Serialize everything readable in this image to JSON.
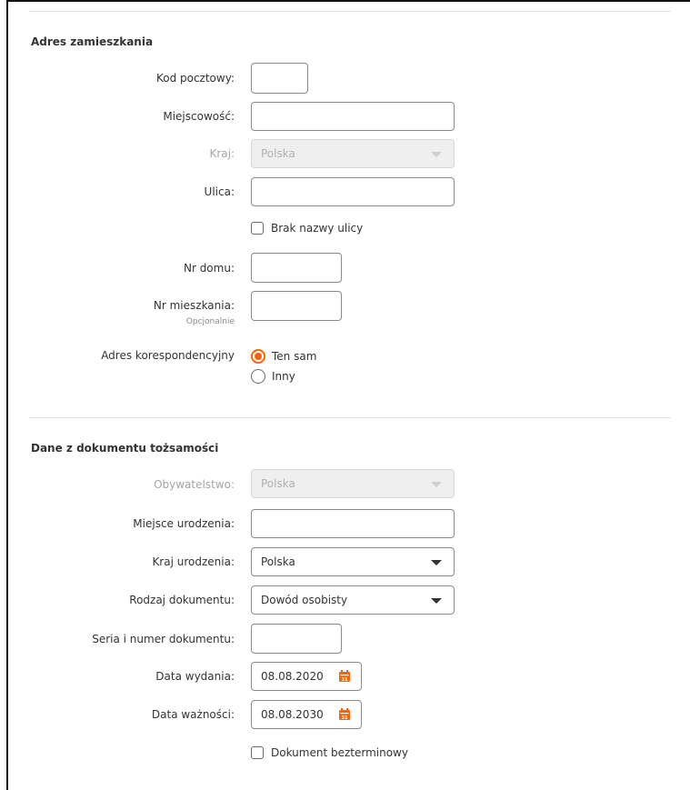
{
  "address": {
    "title": "Adres zamieszkania",
    "postal_code": {
      "label": "Kod pocztowy:",
      "value": ""
    },
    "city": {
      "label": "Miejscowość:",
      "value": ""
    },
    "country": {
      "label": "Kraj:",
      "value": "Polska"
    },
    "street": {
      "label": "Ulica:",
      "value": ""
    },
    "no_street_name": {
      "label": "Brak nazwy ulicy",
      "checked": false
    },
    "house_number": {
      "label": "Nr domu:",
      "value": ""
    },
    "apartment_number": {
      "label": "Nr mieszkania:",
      "sublabel": "Opcjonalnie",
      "value": ""
    },
    "correspondence": {
      "label": "Adres korespondencyjny",
      "options": [
        {
          "label": "Ten sam",
          "selected": true
        },
        {
          "label": "Inny",
          "selected": false
        }
      ]
    }
  },
  "identity": {
    "title": "Dane z dokumentu tożsamości",
    "citizenship": {
      "label": "Obywatelstwo:",
      "value": "Polska"
    },
    "birthplace": {
      "label": "Miejsce urodzenia:",
      "value": ""
    },
    "birth_country": {
      "label": "Kraj urodzenia:",
      "value": "Polska"
    },
    "document_type": {
      "label": "Rodzaj dokumentu:",
      "value": "Dowód osobisty"
    },
    "document_number": {
      "label": "Seria i numer dokumentu:",
      "value": ""
    },
    "issue_date": {
      "label": "Data wydania:",
      "value": "08.08.2020"
    },
    "expiry_date": {
      "label": "Data ważności:",
      "value": "08.08.2030"
    },
    "no_expiry": {
      "label": "Dokument bezterminowy",
      "checked": false
    }
  },
  "colors": {
    "accent": "#ff6200",
    "border": "#8a8a8a",
    "disabled_bg": "#efefef",
    "text": "#333333"
  },
  "icons": {
    "calendar": "calendar-icon",
    "dropdown": "chevron-down-icon"
  }
}
